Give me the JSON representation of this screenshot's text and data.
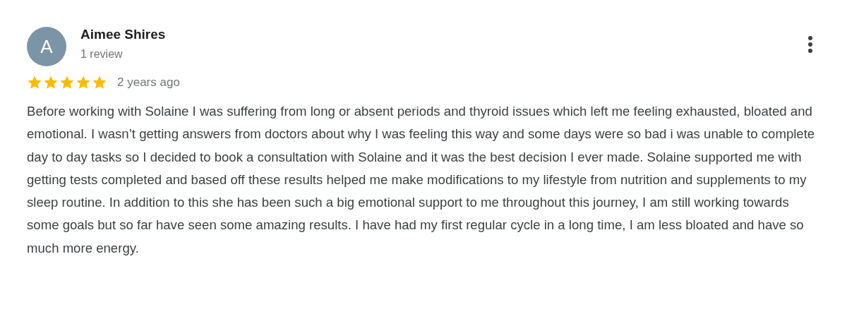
{
  "review": {
    "avatar_letter": "A",
    "author": "Aimee Shires",
    "review_count": "1 review",
    "stars": 5,
    "time": "2 years ago",
    "text": "Before working with Solaine I was suffering from long or absent periods and thyroid issues which left me feeling exhausted, bloated and emotional. I wasn’t getting answers from doctors about why I was feeling this way and some days were so bad i was unable to complete day to day tasks so I decided to book a consultation with Solaine and it was the best decision I ever made. Solaine supported me with getting tests completed and based off these results helped me make modifications to my lifestyle from nutrition and supplements to my sleep routine. In addition to this she has been such a big emotional support to me throughout this journey, I am still working towards some goals but so far have seen some amazing results. I have had my first regular cycle in a long time, I am less bloated and have so much more energy."
  }
}
